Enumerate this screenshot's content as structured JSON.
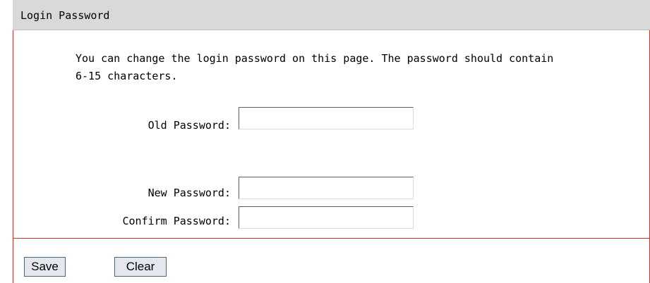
{
  "panel": {
    "title": "Login Password"
  },
  "intro": {
    "text": "You can change the login password on this page. The password should contain 6-15 characters."
  },
  "form": {
    "old_password": {
      "label": "Old Password:",
      "value": ""
    },
    "new_password": {
      "label": "New Password:",
      "value": ""
    },
    "confirm_password": {
      "label": "Confirm Password:",
      "value": ""
    }
  },
  "actions": {
    "save_label": "Save",
    "clear_label": "Clear"
  },
  "colors": {
    "header_bg": "#d9d9d9",
    "border_accent": "#c9342f",
    "button_bg": "#e4e8ee"
  }
}
